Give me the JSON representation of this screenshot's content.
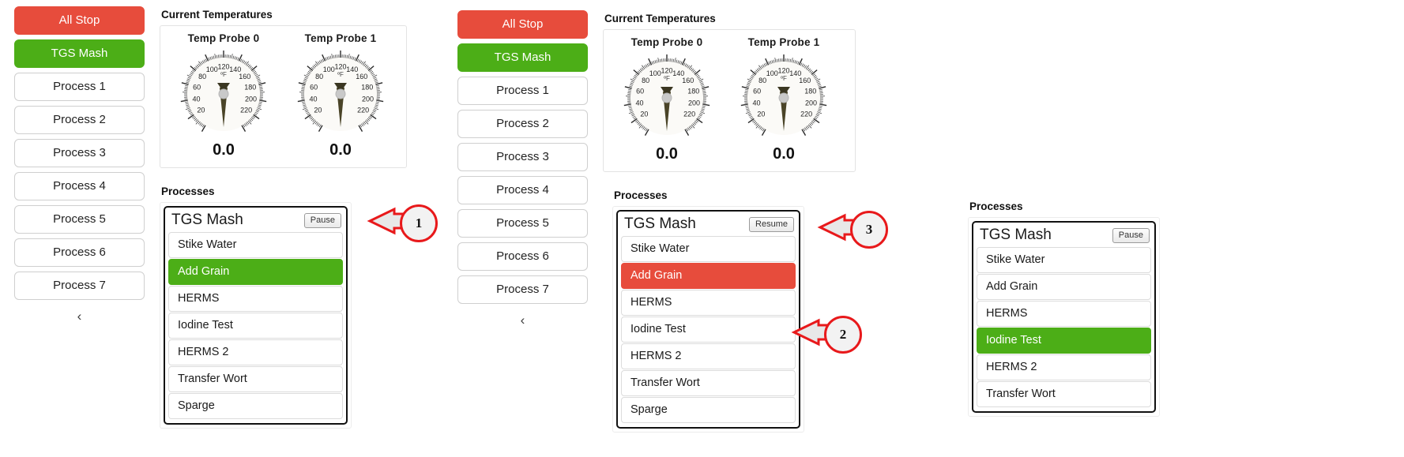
{
  "app": {
    "sidebar": {
      "all_stop": "All Stop",
      "tgs_mash": "TGS Mash",
      "processes": [
        "Process 1",
        "Process 2",
        "Process 3",
        "Process 4",
        "Process 5",
        "Process 6",
        "Process 7"
      ],
      "collapse_icon": "chevron-left",
      "collapse_glyph": "‹"
    },
    "temps": {
      "heading": "Current Temperatures",
      "gauges": [
        {
          "title": "Temp Probe 0",
          "value": "0.0",
          "unit": "ºF",
          "ticks": [
            "20",
            "40",
            "60",
            "80",
            "100",
            "120",
            "140",
            "160",
            "180",
            "200",
            "220"
          ],
          "min": 0,
          "max": 240,
          "reading": 0.0
        },
        {
          "title": "Temp Probe 1",
          "value": "0.0",
          "unit": "ºF",
          "ticks": [
            "20",
            "40",
            "60",
            "80",
            "100",
            "120",
            "140",
            "160",
            "180",
            "200",
            "220"
          ],
          "min": 0,
          "max": 240,
          "reading": 0.0
        }
      ]
    },
    "processes_heading": "Processes"
  },
  "panels": [
    {
      "id": "panel-running",
      "process_title": "TGS Mash",
      "toggle_label": "Pause",
      "steps": [
        {
          "label": "Stike Water",
          "state": "idle"
        },
        {
          "label": "Add Grain",
          "state": "active-green"
        },
        {
          "label": "HERMS",
          "state": "idle"
        },
        {
          "label": "Iodine Test",
          "state": "idle"
        },
        {
          "label": "HERMS 2",
          "state": "idle"
        },
        {
          "label": "Transfer Wort",
          "state": "idle"
        },
        {
          "label": "Sparge",
          "state": "idle"
        }
      ]
    },
    {
      "id": "panel-paused",
      "process_title": "TGS Mash",
      "toggle_label": "Resume",
      "steps": [
        {
          "label": "Stike Water",
          "state": "idle"
        },
        {
          "label": "Add Grain",
          "state": "active-red"
        },
        {
          "label": "HERMS",
          "state": "idle"
        },
        {
          "label": "Iodine Test",
          "state": "idle"
        },
        {
          "label": "HERMS 2",
          "state": "idle"
        },
        {
          "label": "Transfer Wort",
          "state": "idle"
        },
        {
          "label": "Sparge",
          "state": "idle"
        }
      ]
    },
    {
      "id": "panel-advanced",
      "process_title": "TGS Mash",
      "toggle_label": "Pause",
      "steps": [
        {
          "label": "Stike Water",
          "state": "idle"
        },
        {
          "label": "Add Grain",
          "state": "idle"
        },
        {
          "label": "HERMS",
          "state": "idle"
        },
        {
          "label": "Iodine Test",
          "state": "active-green"
        },
        {
          "label": "HERMS 2",
          "state": "idle"
        },
        {
          "label": "Transfer Wort",
          "state": "idle"
        }
      ]
    }
  ],
  "annotations": [
    {
      "number": "1",
      "target": "pause-button-panel-1"
    },
    {
      "number": "2",
      "target": "iodine-test-step-panel-2"
    },
    {
      "number": "3",
      "target": "resume-button-panel-2"
    }
  ],
  "colors": {
    "stop_red": "#e74c3c",
    "active_green": "#4cae17",
    "annotation_red": "#e8191b",
    "text": "#1a1a1a"
  }
}
